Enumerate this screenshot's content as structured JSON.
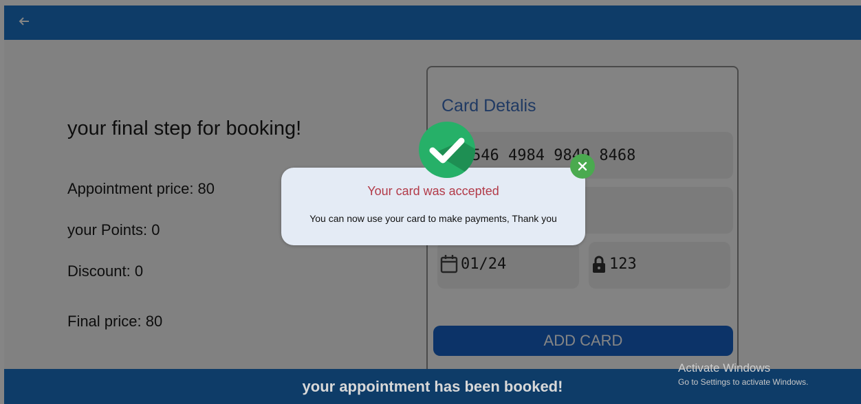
{
  "appbar": {
    "back_icon": "arrow-left-icon"
  },
  "summary": {
    "heading": "your final step for booking!",
    "appointment_price": "Appointment price: 80",
    "points": "your Points: 0",
    "discount": "Discount: 0",
    "final_price": "Final price: 80"
  },
  "card": {
    "title": "Card Detalis",
    "number_visible": "546 4984 9849 8468",
    "expiry_icon": "calendar-icon",
    "expiry": "01/24",
    "cvv_icon": "lock-icon",
    "cvv": "123",
    "add_button": "ADD CARD"
  },
  "footer": {
    "message": "your appointment has been booked!"
  },
  "dialog": {
    "title": "Your card was accepted",
    "message": "You can now use your card to make payments, Thank you",
    "status_icon": "check-icon",
    "close_icon": "close-icon"
  },
  "watermark": {
    "line1": "Activate Windows",
    "line2": "Go to Settings to activate Windows."
  },
  "colors": {
    "brand": "#1b74c7",
    "accent": "#3e6fbf",
    "button": "#1762c7",
    "success": "#26b068",
    "error_text": "#b23a48"
  }
}
